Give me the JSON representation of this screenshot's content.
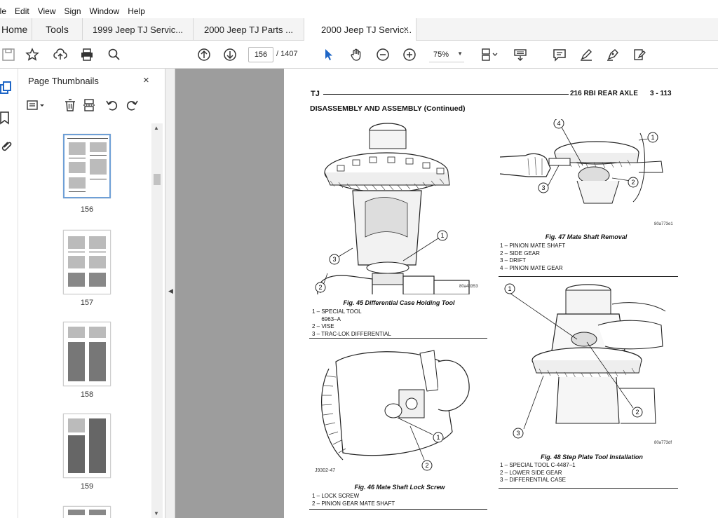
{
  "menu": [
    "ile",
    "Edit",
    "View",
    "Sign",
    "Window",
    "Help"
  ],
  "tabs": {
    "home": "Home",
    "tools": "Tools",
    "docs": [
      "1999 Jeep TJ Servic...",
      "2000 Jeep TJ Parts ...",
      "2000 Jeep TJ Servic..."
    ],
    "close": "×"
  },
  "toolbar": {
    "page_current": "156",
    "page_total": "/ 1407",
    "zoom": "75%"
  },
  "thumbnails": {
    "title": "Page Thumbnails",
    "close": "×",
    "pages": [
      "156",
      "157",
      "158",
      "159"
    ]
  },
  "document": {
    "header_left": "TJ",
    "header_title": "216 RBI REAR AXLE",
    "header_page": "3 - 113",
    "section": "DISASSEMBLY AND ASSEMBLY (Continued)",
    "figures": [
      {
        "caption": "Fig. 45 Differential Case Holding Tool",
        "code": "80a4d353",
        "legend": [
          "1 – SPECIAL TOOL",
          "      6963–A",
          "2 – VISE",
          "3 – TRAC-LOK DIFFERENTIAL"
        ]
      },
      {
        "caption": "Fig. 46 Mate Shaft Lock Screw",
        "code": "J9302-47",
        "legend": [
          "1 – LOCK SCREW",
          "2 – PINION GEAR MATE SHAFT"
        ]
      },
      {
        "caption": "Fig. 47 Mate Shaft Removal",
        "code": "80a773e1",
        "legend": [
          "1 – PINION MATE SHAFT",
          "2 – SIDE GEAR",
          "3 – DRIFT",
          "4 – PINION MATE GEAR"
        ]
      },
      {
        "caption": "Fig. 48 Step Plate Tool Installation",
        "code": "80a773df",
        "legend": [
          "1 – SPECIAL TOOL C-4487–1",
          "2 – LOWER SIDE GEAR",
          "3 – DIFFERENTIAL CASE"
        ]
      }
    ]
  },
  "callouts": [
    "1",
    "2",
    "3",
    "4"
  ]
}
